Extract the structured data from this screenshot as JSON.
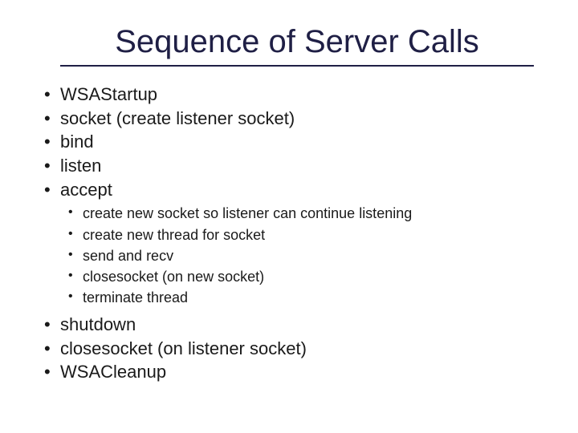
{
  "title": "Sequence of Server Calls",
  "bullets": {
    "0": "WSAStartup",
    "1": "socket (create listener socket)",
    "2": "bind",
    "3": "listen",
    "4": "accept",
    "5": "shutdown",
    "6": "closesocket (on listener socket)",
    "7": "WSACleanup"
  },
  "sub_bullets": {
    "0": "create new socket so listener can continue listening",
    "1": "create new thread for socket",
    "2": "send and recv",
    "3": "closesocket (on new socket)",
    "4": "terminate thread"
  }
}
